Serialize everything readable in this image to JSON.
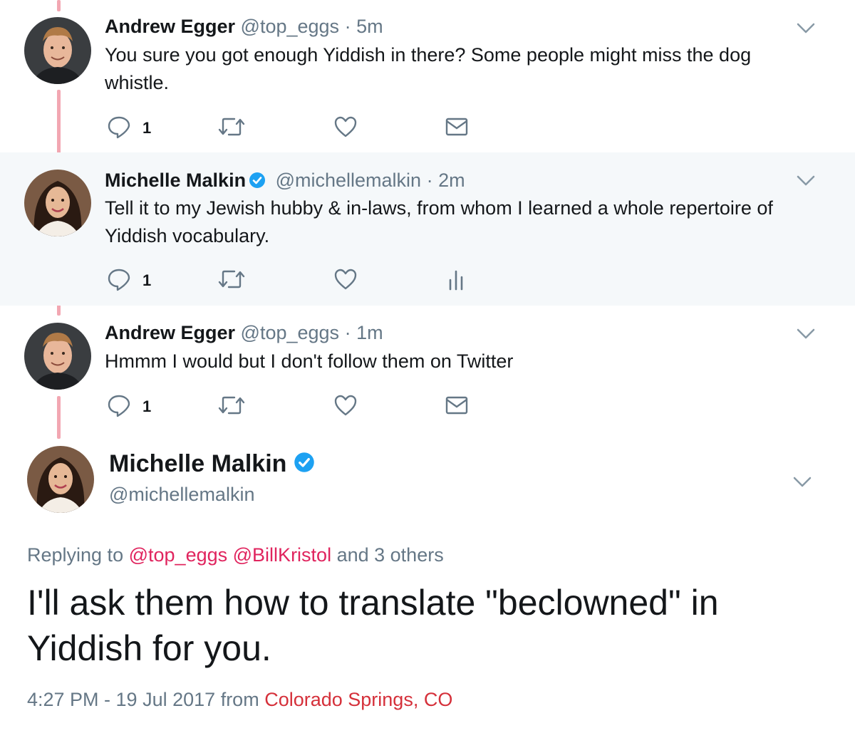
{
  "thread": [
    {
      "author_name": "Andrew Egger",
      "author_handle": "@top_eggs",
      "separator": "·",
      "time": "5m",
      "text": "You sure you got enough Yiddish in there? Some people might miss the dog whistle.",
      "verified": false,
      "reply_count": "1",
      "fourth_action_icon": "envelope-icon"
    },
    {
      "author_name": "Michelle Malkin",
      "author_handle": "@michellemalkin",
      "separator": "·",
      "time": "2m",
      "text": "Tell it to my Jewish hubby & in-laws, from whom I learned a whole repertoire of Yiddish vocabulary.",
      "verified": true,
      "reply_count": "1",
      "fourth_action_icon": "analytics-icon"
    },
    {
      "author_name": "Andrew Egger",
      "author_handle": "@top_eggs",
      "separator": "·",
      "time": "1m",
      "text": "Hmmm I would but I don't follow them on Twitter",
      "verified": false,
      "reply_count": "1",
      "fourth_action_icon": "envelope-icon"
    }
  ],
  "main_tweet": {
    "author_name": "Michelle Malkin",
    "author_handle": "@michellemalkin",
    "verified": true,
    "replying_prefix": "Replying to",
    "replying_mention_1": "@top_eggs",
    "replying_mention_2": "@BillKristol",
    "replying_suffix": "and 3 others",
    "text": "I'll ask them how to translate \"beclowned\" in Yiddish for you.",
    "timestamp": "4:27 PM - 19 Jul 2017",
    "from_label": "from",
    "location": "Colorado Springs, CO"
  },
  "colors": {
    "thread_line": "#f2a7b2",
    "link": "#e0245e",
    "location": "#d5303a",
    "verified": "#1da1f2",
    "highlight_bg": "#f5f8fa",
    "muted_text": "#657786"
  }
}
